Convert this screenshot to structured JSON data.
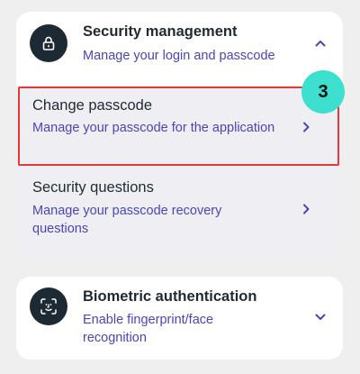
{
  "security_section": {
    "title": "Security management",
    "subtitle": "Manage your login and passcode",
    "icon": "lock-icon",
    "expanded": true,
    "items": [
      {
        "title": "Change passcode",
        "subtitle": "Manage your passcode for the application",
        "icon": "chevron-right-icon"
      },
      {
        "title": "Security questions",
        "subtitle": "Manage your passcode recovery questions",
        "icon": "chevron-right-icon"
      }
    ]
  },
  "biometric_section": {
    "title": "Biometric authentication",
    "subtitle": "Enable fingerprint/face recognition",
    "icon": "face-scan-icon",
    "expanded": false
  },
  "annotation": {
    "step_number": "3",
    "badge_color": "#3de0cf",
    "highlight_color": "#e53935"
  },
  "colors": {
    "accent": "#4a45b8",
    "icon_bg": "#1d2a33",
    "background": "#efefef"
  }
}
